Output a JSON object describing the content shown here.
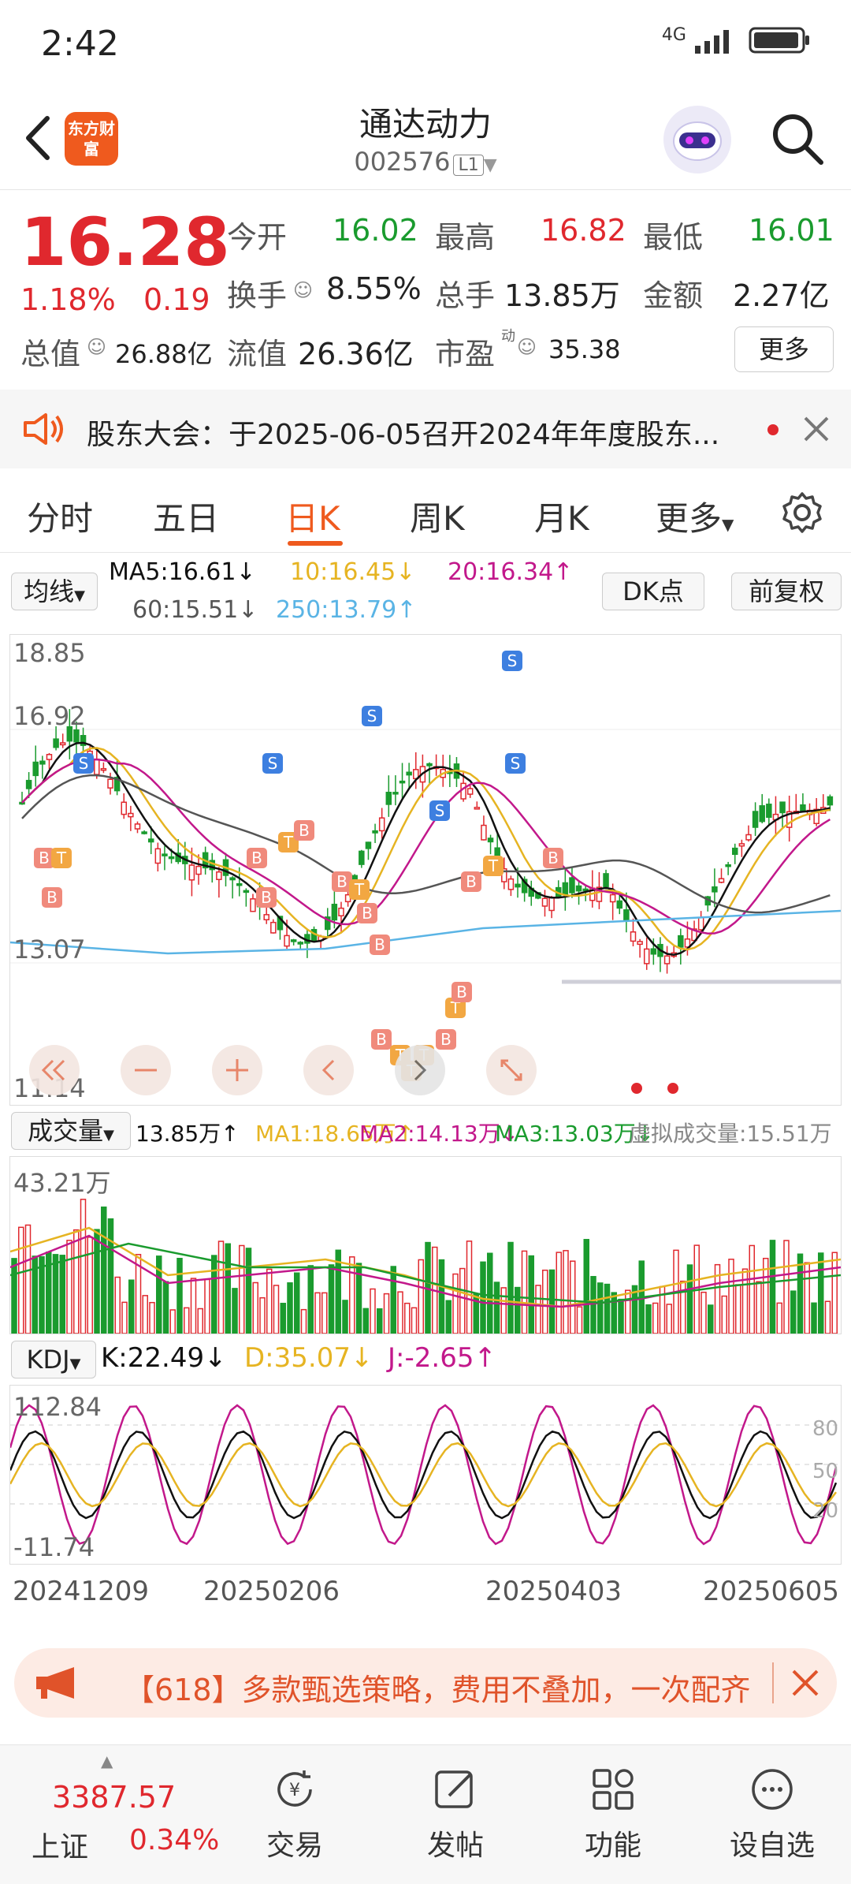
{
  "status_bar": {
    "time": "2:42",
    "network": "4G"
  },
  "header": {
    "logo_text": "东方财富",
    "title": "通达动力",
    "code": "002576",
    "level": "L1"
  },
  "quote": {
    "price": "16.28",
    "change_pct": "1.18%",
    "change_amt": "0.19",
    "open_label": "今开",
    "open": "16.02",
    "high_label": "最高",
    "high": "16.82",
    "low_label": "最低",
    "low": "16.01",
    "turnover_label": "换手",
    "turnover": "8.55%",
    "volume_label": "总手",
    "volume": "13.85万",
    "amount_label": "金额",
    "amount": "2.27亿",
    "mktcap_label": "总值",
    "mktcap": "26.88亿",
    "float_label": "流值",
    "float": "26.36亿",
    "pe_label": "市盈",
    "pe_sup": "动",
    "pe": "35.38",
    "more_label": "更多"
  },
  "notice": {
    "text": "股东大会：于2025-06-05召开2024年年度股东..."
  },
  "tabs": [
    {
      "label": "分时"
    },
    {
      "label": "五日"
    },
    {
      "label": "日K"
    },
    {
      "label": "周K"
    },
    {
      "label": "月K"
    },
    {
      "label": "更多"
    }
  ],
  "ma": {
    "selector": "均线",
    "ma5": "MA5:16.61↓",
    "ma10": "10:16.45↓",
    "ma20": "20:16.34↑",
    "ma60": "60:15.51↓",
    "ma250": "250:13.79↑",
    "dk_label": "DK点",
    "adjust_label": "前复权"
  },
  "price_axis": {
    "top": "18.85",
    "upper": "16.92",
    "lower": "13.07",
    "bottom": "11.14"
  },
  "volume": {
    "selector": "成交量",
    "value": "13.85万↑",
    "ma1": "MA1:18.65万↑",
    "ma2": "MA2:14.13万↓",
    "ma3": "MA3:13.03万↓",
    "virtual": "虚拟成交量:15.51万",
    "axis_max": "43.21万"
  },
  "kdj": {
    "selector": "KDJ",
    "k": "K:22.49↓",
    "d": "D:35.07↓",
    "j": "J:-2.65↑",
    "axis_top": "112.84",
    "axis_bottom": "-11.74",
    "level_80": "80",
    "level_50": "50",
    "level_20": "20"
  },
  "dates": [
    "20241209",
    "20250206",
    "20250403",
    "20250605"
  ],
  "banner": {
    "text": "【618】多款甄选策略，费用不叠加，一次配齐"
  },
  "bottom_nav": {
    "index_value": "3387.57",
    "index_name": "上证",
    "index_change": "0.34%",
    "items": [
      {
        "label": "交易"
      },
      {
        "label": "发帖"
      },
      {
        "label": "功能"
      },
      {
        "label": "设自选"
      }
    ]
  },
  "colors": {
    "up": "#e0282e",
    "down": "#1a9b2e",
    "accent": "#ef5a1e",
    "ma5": "#111111",
    "ma10": "#e6b422",
    "ma20": "#c2188b",
    "ma60": "#555555",
    "ma250": "#5ab4e5"
  }
}
